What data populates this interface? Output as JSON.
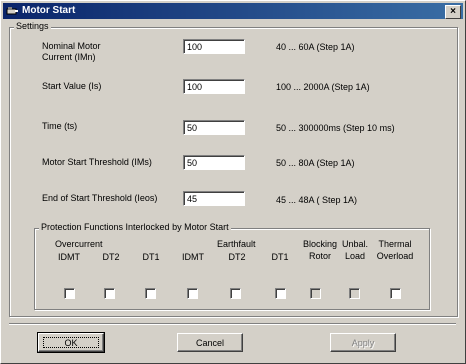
{
  "window": {
    "title": "Motor Start",
    "close_glyph": "×"
  },
  "settings": {
    "group_label": "Settings",
    "rows": [
      {
        "label_line1": "Nominal Motor",
        "label_line2": "Current (IMn)",
        "value": "100",
        "range": "40 ... 60A (Step 1A)"
      },
      {
        "label": "Start Value (Is)",
        "value": "100",
        "range": "100 ... 2000A (Step 1A)"
      },
      {
        "label": "Time (ts)",
        "value": "50",
        "range": "50 ... 300000ms (Step 10 ms)"
      },
      {
        "label": "Motor Start Threshold (IMs)",
        "value": "50",
        "range": "50 ... 80A (Step 1A)"
      },
      {
        "label": "End of Start Threshold (Ieos)",
        "value": "45",
        "range": "45 ... 48A ( Step 1A)"
      }
    ]
  },
  "protection": {
    "group_label": "Protection Functions Interlocked by Motor Start",
    "overcurrent": "Overcurrent",
    "earthfault": "Earthfault",
    "columns": [
      {
        "line1": "IDMT",
        "checked": false,
        "enabled": true
      },
      {
        "line1": "DT2",
        "checked": false,
        "enabled": true
      },
      {
        "line1": "DT1",
        "checked": false,
        "enabled": true
      },
      {
        "line1": "IDMT",
        "checked": false,
        "enabled": true
      },
      {
        "line1": "DT2",
        "checked": false,
        "enabled": true
      },
      {
        "line1": "DT1",
        "checked": false,
        "enabled": true
      },
      {
        "line1": "Blocking",
        "line2": "Rotor",
        "checked": false,
        "enabled": false
      },
      {
        "line1": "Unbal.",
        "line2": "Load",
        "checked": false,
        "enabled": false
      },
      {
        "line1": "Thermal",
        "line2": "Overload",
        "checked": false,
        "enabled": true
      }
    ]
  },
  "buttons": {
    "ok": "OK",
    "cancel": "Cancel",
    "apply": "Apply"
  }
}
